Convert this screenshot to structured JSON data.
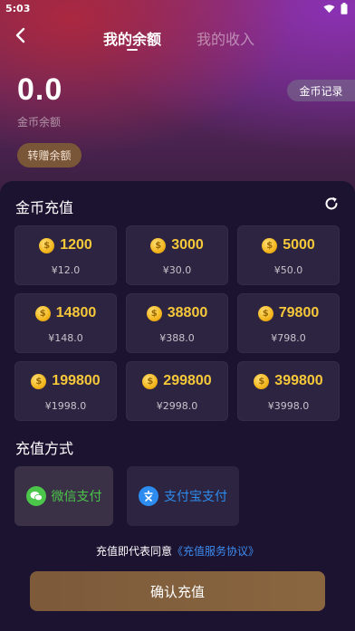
{
  "status_bar": {
    "time": "5:03"
  },
  "nav": {
    "tabs": [
      {
        "label": "我的余额",
        "active": true
      },
      {
        "label": "我的收入",
        "active": false
      }
    ]
  },
  "balance": {
    "value": "0.0",
    "label": "金币余额",
    "record_button": "金币记录",
    "transfer_button": "转赠余额"
  },
  "recharge": {
    "title": "金币充值",
    "packages": [
      {
        "coins": "1200",
        "price": "¥12.0"
      },
      {
        "coins": "3000",
        "price": "¥30.0"
      },
      {
        "coins": "5000",
        "price": "¥50.0"
      },
      {
        "coins": "14800",
        "price": "¥148.0"
      },
      {
        "coins": "38800",
        "price": "¥388.0"
      },
      {
        "coins": "79800",
        "price": "¥798.0"
      },
      {
        "coins": "199800",
        "price": "¥1998.0"
      },
      {
        "coins": "299800",
        "price": "¥2998.0"
      },
      {
        "coins": "399800",
        "price": "¥3998.0"
      }
    ]
  },
  "payment": {
    "title": "充值方式",
    "methods": [
      {
        "label": "微信支付",
        "icon": "wechat-icon",
        "color": "#4bc54a",
        "selected": true
      },
      {
        "label": "支付宝支付",
        "icon": "alipay-icon",
        "color": "#2d8cf0",
        "selected": false
      }
    ]
  },
  "agreement": {
    "prefix": "充值即代表同意",
    "link": "《充值服务协议》"
  },
  "confirm_button": "确认充值",
  "colors": {
    "accent_gold": "#f6c83a",
    "button_brown": "#7c5a3a",
    "link_blue": "#3d8cf0"
  }
}
